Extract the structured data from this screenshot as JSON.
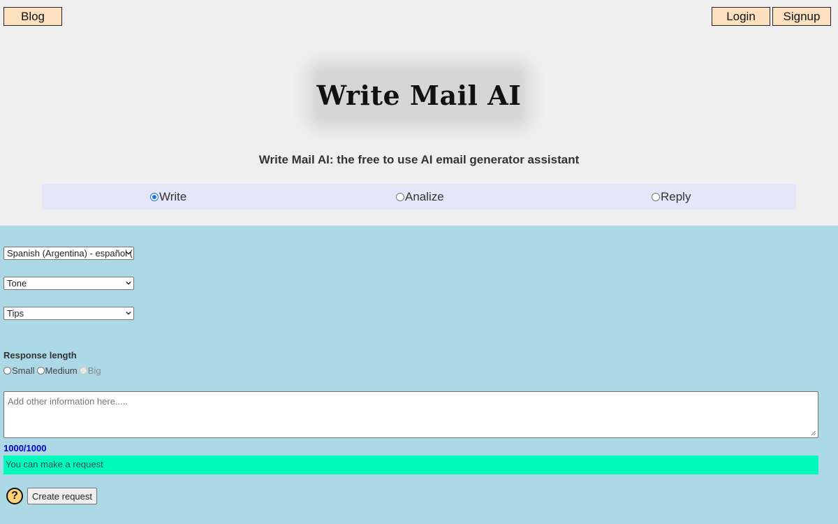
{
  "nav": {
    "blog_label": "Blog",
    "login_label": "Login",
    "signup_label": "Signup"
  },
  "logo": {
    "text": "Write Mail AI"
  },
  "subtitle": "Write Mail AI: the free to use AI email generator assistant",
  "modes": [
    {
      "label": "Write",
      "checked": true
    },
    {
      "label": "Analize",
      "checked": false
    },
    {
      "label": "Reply",
      "checked": false
    }
  ],
  "form": {
    "language_select": "Spanish (Argentina) - español (",
    "tone_select": "Tone",
    "tips_select": "Tips",
    "response_length_label": "Response length",
    "response_length_options": [
      {
        "label": "Small",
        "checked": false,
        "disabled": false
      },
      {
        "label": "Medium",
        "checked": false,
        "disabled": false
      },
      {
        "label": "Big",
        "checked": false,
        "disabled": true
      }
    ],
    "textarea_placeholder": "Add other information here.....",
    "counter": "1000/1000",
    "status_message": "You can make a request",
    "help_symbol": "?",
    "create_button_label": "Create request"
  },
  "colors": {
    "page_bg": "#efefef",
    "form_bg": "#add8e6",
    "nav_button_bg": "#fde0bf",
    "mode_bar_bg": "#e6e6fa",
    "status_bg": "#00fabb",
    "counter_color": "#0000cd",
    "radio_accent": "#1a73e8"
  }
}
